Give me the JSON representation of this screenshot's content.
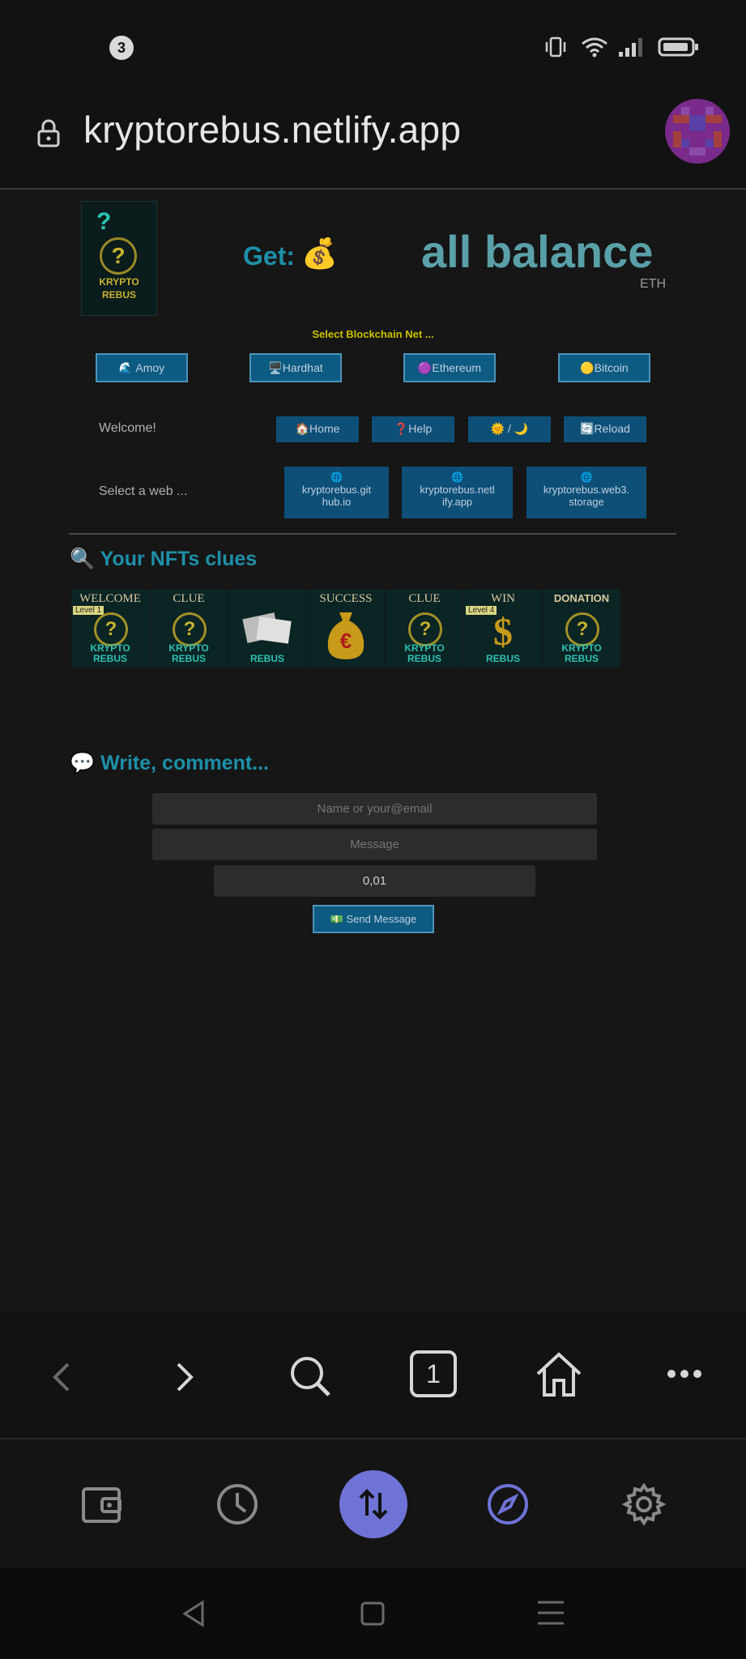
{
  "status_bar": {
    "notification_count": "3",
    "icons": [
      "vibrate-icon",
      "wifi-icon",
      "signal-icon",
      "battery-icon"
    ]
  },
  "browser": {
    "url": "kryptorebus.netlify.app"
  },
  "logo": {
    "line1": "KRYPTO",
    "line2": "REBUS"
  },
  "header": {
    "get_label": "Get:",
    "get_emoji": "💰",
    "balance_label": "all balance",
    "currency": "ETH"
  },
  "chain": {
    "title": "Select Blockchain Net ...",
    "options": [
      "🌊 Amoy",
      "🖥️Hardhat",
      "🟣Ethereum",
      "🟡Bitcoin"
    ]
  },
  "nav": {
    "welcome": "Welcome!",
    "home": "🏠Home",
    "help": "❓Help",
    "theme": "🌞 / 🌙",
    "reload": "🔄Reload"
  },
  "web": {
    "label": "Select a web ...",
    "links": [
      {
        "icon": "🌐",
        "line1": "kryptorebus.git",
        "line2": "hub.io"
      },
      {
        "icon": "🌐",
        "line1": "kryptorebus.netl",
        "line2": "ify.app"
      },
      {
        "icon": "🌐",
        "line1": "kryptorebus.web3.",
        "line2": "storage"
      }
    ]
  },
  "nfts": {
    "title_icon": "🔍",
    "title": "Your NFTs clues",
    "items": [
      {
        "caption": "WELCOME",
        "level": "Level 1",
        "brand1": "KRYPTO",
        "brand2": "REBUS"
      },
      {
        "caption": "CLUE",
        "level": "",
        "brand1": "KRYPTO",
        "brand2": "REBUS"
      },
      {
        "caption": "",
        "level": "",
        "brand1": "",
        "brand2": "REBUS"
      },
      {
        "caption": "SUCCESS",
        "level": "",
        "brand1": "",
        "brand2": ""
      },
      {
        "caption": "CLUE",
        "level": "",
        "brand1": "KRYPTO",
        "brand2": "REBUS"
      },
      {
        "caption": "WIN",
        "level": "Level 4",
        "brand1": "",
        "brand2": "REBUS"
      },
      {
        "caption": "DONATION",
        "level": "",
        "brand1": "KRYPTO",
        "brand2": "REBUS"
      }
    ]
  },
  "comment": {
    "title_icon": "💬",
    "title": "Write, comment...",
    "name_placeholder": "Name or your@email",
    "message_placeholder": "Message",
    "amount_value": "0,01",
    "send_label": "💵 Send Message"
  },
  "browser_toolbar": {
    "tab_count": "1"
  },
  "colors": {
    "accent": "#1e8fa8",
    "button": "#0d5a82",
    "balance": "#5aa0a8",
    "center_action": "#6f73d6"
  }
}
